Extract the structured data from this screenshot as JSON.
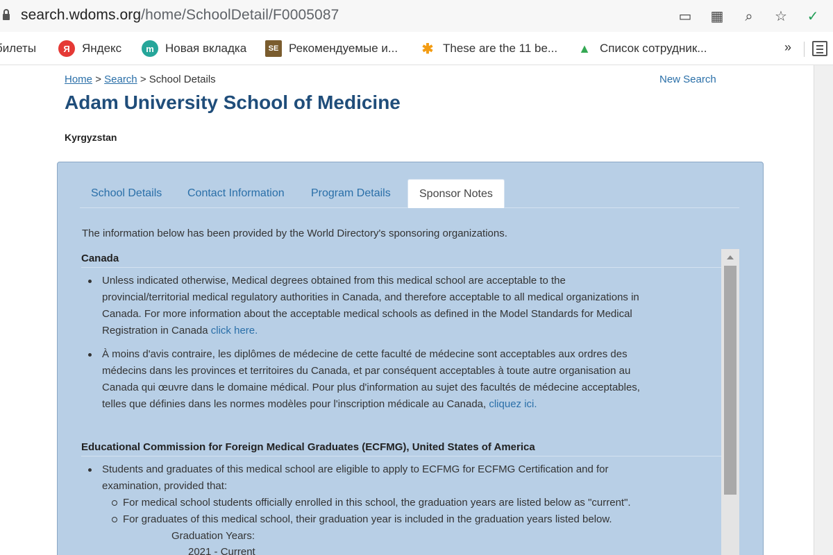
{
  "browser": {
    "url_host": "search.wdoms.org",
    "url_path": "/home/SchoolDetail/F0005087",
    "tools": [
      {
        "icon": "cast-icon",
        "glyph": "▭"
      },
      {
        "icon": "qr-code-icon",
        "glyph": "▦"
      },
      {
        "icon": "zoom-icon",
        "glyph": "⌕"
      },
      {
        "icon": "bookmark-star-icon",
        "glyph": "☆"
      },
      {
        "icon": "extension-icon",
        "glyph": "✓"
      }
    ],
    "bookmarks": [
      {
        "label": "билеты",
        "icon": ""
      },
      {
        "label": "Яндекс",
        "icon": "yandex-icon",
        "glyph": "Я",
        "color": "#e53935"
      },
      {
        "label": "Новая вкладка",
        "icon": "new-tab-icon",
        "glyph": "m",
        "color": "#26a69a"
      },
      {
        "label": "Рекомендуемые и...",
        "icon": "se-icon",
        "glyph": "SE",
        "color": "#7a5c2e"
      },
      {
        "label": "These are the 11 be...",
        "icon": "nbc-icon",
        "glyph": "✱",
        "color": "#f39c12"
      },
      {
        "label": "Список сотрудник...",
        "icon": "drive-icon",
        "glyph": "▲",
        "color": "#34a853"
      }
    ],
    "more": "»"
  },
  "page": {
    "breadcrumb": {
      "home": "Home",
      "sep1": ">",
      "search": "Search",
      "sep2": ">",
      "current": "School Details"
    },
    "new_search": "New Search",
    "title": "Adam University School of Medicine",
    "country": "Kyrgyzstan",
    "tabs": [
      "School Details",
      "Contact Information",
      "Program Details",
      "Sponsor Notes"
    ],
    "active_tab": "Sponsor Notes",
    "intro": "The information below has been provided by the World Directory's sponsoring organizations.",
    "canada": {
      "heading": "Canada",
      "b1_lines": [
        "Unless indicated otherwise, Medical degrees obtained from this medical school are acceptable to the",
        "provincial/territorial medical regulatory authorities in Canada, and therefore acceptable to all medical organizations in",
        "Canada. For more information about the acceptable medical schools as defined in the Model Standards for Medical",
        "Registration in Canada "
      ],
      "b1_link": "click here.",
      "b2_lines": [
        "À moins d'avis contraire, les diplômes de médecine de cette faculté de médecine sont acceptables aux ordres des",
        "médecins dans les provinces et territoires du Canada, et par conséquent acceptables à toute autre organisation au",
        "Canada qui œuvre dans le domaine médical. Pour plus d'information au sujet des facultés de médecine acceptables,",
        "telles que définies dans les normes modèles pour l'inscription médicale au Canada, "
      ],
      "b2_link": "cliquez ici."
    },
    "ecfmg": {
      "heading": "Educational Commission for Foreign Medical Graduates (ECFMG), United States of America",
      "b1_lines": [
        "Students and graduates of this medical school are eligible to apply to ECFMG for ECFMG Certification and for",
        "examination, provided that:"
      ],
      "sub1": "For medical school students officially enrolled in this school, the graduation years are listed below as \"current\".",
      "sub2": "For graduates of this medical school, their graduation year is included in the graduation years listed below.",
      "grad_label": "Graduation Years:",
      "grad_value": "2021 - Current"
    }
  }
}
